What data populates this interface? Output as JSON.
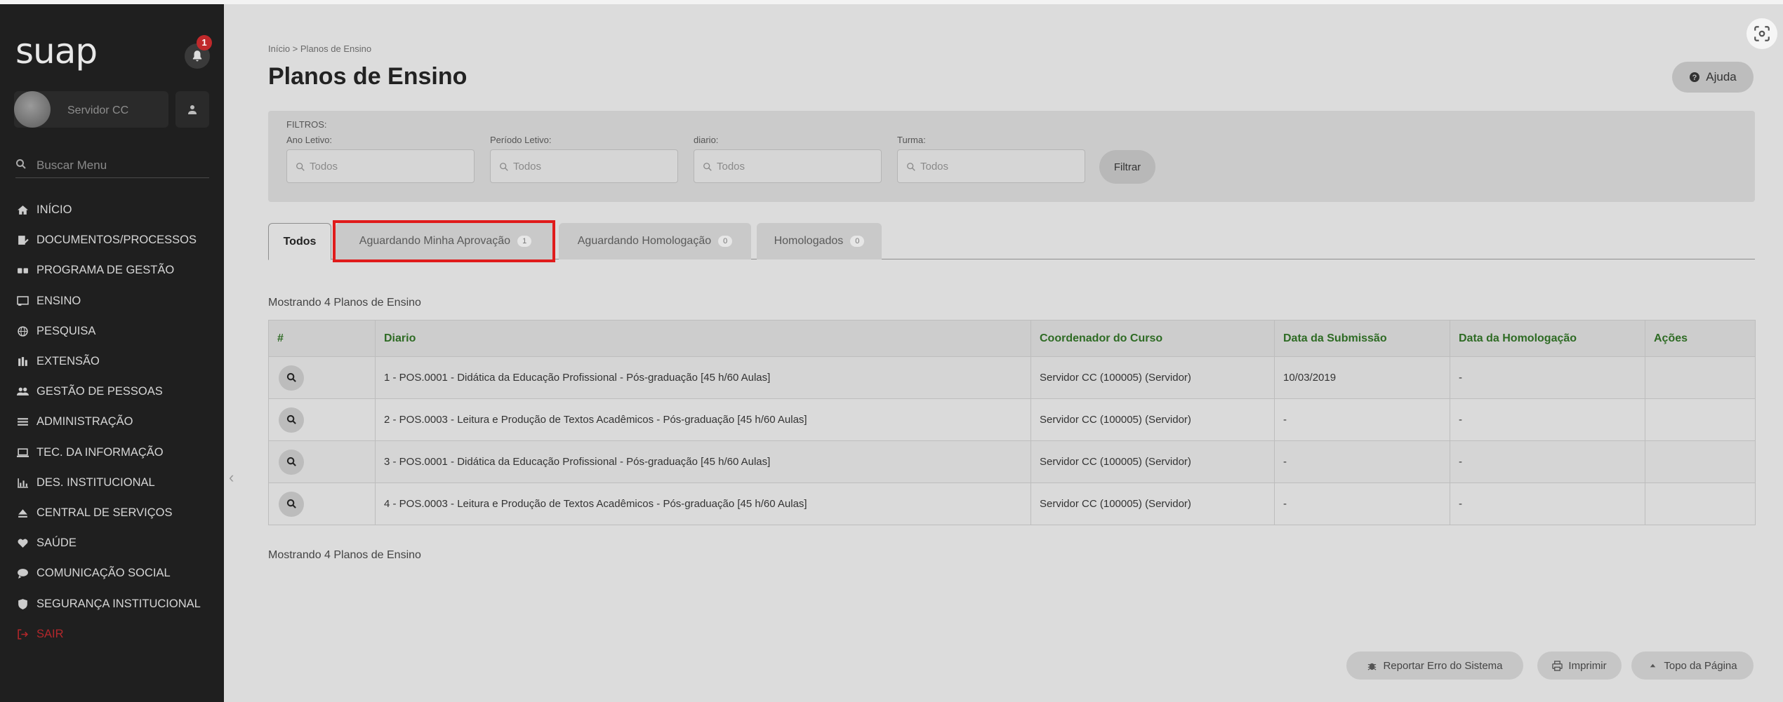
{
  "app": {
    "logo": "suap",
    "notifications": "1"
  },
  "user": {
    "name": "Servidor CC"
  },
  "sidebar": {
    "search_placeholder": "Buscar Menu",
    "items": [
      {
        "label": "INÍCIO",
        "icon": "home-icon"
      },
      {
        "label": "DOCUMENTOS/PROCESSOS",
        "icon": "file-signature-icon"
      },
      {
        "label": "PROGRAMA DE GESTÃO",
        "icon": "handshake-icon"
      },
      {
        "label": "ENSINO",
        "icon": "chalkboard-icon"
      },
      {
        "label": "PESQUISA",
        "icon": "globe-icon"
      },
      {
        "label": "EXTENSÃO",
        "icon": "building-icon"
      },
      {
        "label": "GESTÃO DE PESSOAS",
        "icon": "users-icon"
      },
      {
        "label": "ADMINISTRAÇÃO",
        "icon": "list-icon"
      },
      {
        "label": "TEC. DA INFORMAÇÃO",
        "icon": "laptop-icon"
      },
      {
        "label": "DES. INSTITUCIONAL",
        "icon": "chart-icon"
      },
      {
        "label": "CENTRAL DE SERVIÇOS",
        "icon": "eject-icon"
      },
      {
        "label": "SAÚDE",
        "icon": "heartbeat-icon"
      },
      {
        "label": "COMUNICAÇÃO SOCIAL",
        "icon": "comment-icon"
      },
      {
        "label": "SEGURANÇA INSTITUCIONAL",
        "icon": "shield-icon"
      },
      {
        "label": "SAIR",
        "icon": "sign-out-icon"
      }
    ]
  },
  "header": {
    "breadcrumb": "Início  >  Planos de Ensino",
    "title": "Planos de Ensino",
    "help": "Ajuda"
  },
  "filters": {
    "title": "FILTROS:",
    "fields": [
      {
        "label": "Ano Letivo:",
        "placeholder": "Todos"
      },
      {
        "label": "Período Letivo:",
        "placeholder": "Todos"
      },
      {
        "label": "diario:",
        "placeholder": "Todos"
      },
      {
        "label": "Turma:",
        "placeholder": "Todos"
      }
    ],
    "submit": "Filtrar"
  },
  "tabs": [
    {
      "label": "Todos",
      "count": ""
    },
    {
      "label": "Aguardando Minha Aprovação",
      "count": "1"
    },
    {
      "label": "Aguardando Homologação",
      "count": "0"
    },
    {
      "label": "Homologados",
      "count": "0"
    }
  ],
  "showing": "Mostrando 4 Planos de Ensino",
  "table": {
    "headers": [
      "#",
      "Diario",
      "Coordenador do Curso",
      "Data da Submissão",
      "Data da Homologação",
      "Ações"
    ],
    "rows": [
      {
        "diario": "1 - POS.0001 - Didática da Educação Profissional - Pós-graduação [45 h/60 Aulas]",
        "coordenador": "Servidor CC (100005) (Servidor)",
        "submissao": "10/03/2019",
        "homologacao": "-",
        "acoes": ""
      },
      {
        "diario": "2 - POS.0003 - Leitura e Produção de Textos Acadêmicos - Pós-graduação [45 h/60 Aulas]",
        "coordenador": "Servidor CC (100005) (Servidor)",
        "submissao": "-",
        "homologacao": "-",
        "acoes": ""
      },
      {
        "diario": "3 - POS.0001 - Didática da Educação Profissional - Pós-graduação [45 h/60 Aulas]",
        "coordenador": "Servidor CC (100005) (Servidor)",
        "submissao": "-",
        "homologacao": "-",
        "acoes": ""
      },
      {
        "diario": "4 - POS.0003 - Leitura e Produção de Textos Acadêmicos - Pós-graduação [45 h/60 Aulas]",
        "coordenador": "Servidor CC (100005) (Servidor)",
        "submissao": "-",
        "homologacao": "-",
        "acoes": ""
      }
    ]
  },
  "footer": {
    "report": "Reportar Erro do Sistema",
    "print": "Imprimir",
    "top": "Topo da Página"
  },
  "colors": {
    "sidebar": "#1f1f1f",
    "header_green": "#2e6b24",
    "highlight": "#e01b1b",
    "sair": "#b2272b"
  }
}
